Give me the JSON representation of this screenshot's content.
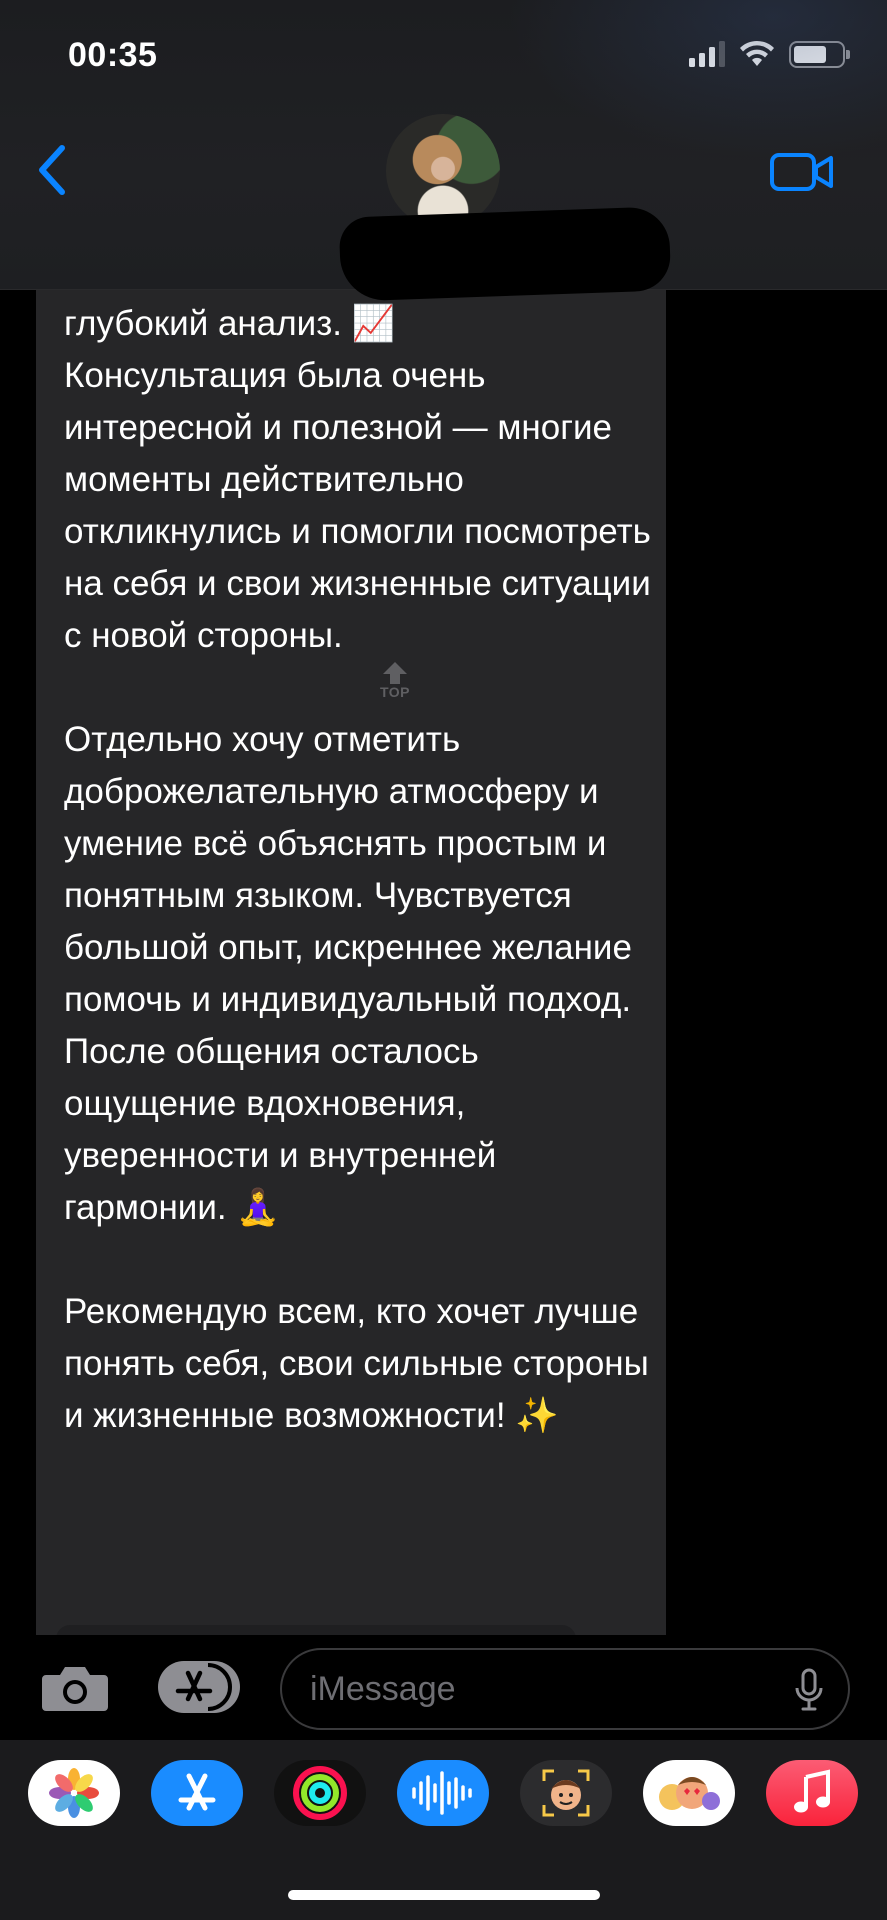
{
  "status_bar": {
    "time": "00:35"
  },
  "header": {
    "contact_avatar": "contact-photo",
    "back_icon": "chevron-left-icon",
    "video_icon": "video-camera-icon"
  },
  "conversation": {
    "message_text": "глубокий анализ. 📈\nКонсультация была очень интересной и полезной — многие моменты действительно откликнулись и помогли посмотреть на себя и свои жизненные ситуации с новой стороны.\n\nОтдельно хочу отметить доброжелательную атмосферу и умение всё объяснять простым и понятным языком. Чувствуется большой опыт, искреннее желание помочь и индивидуальный подход. После общения осталось ощущение вдохновения, уверенности и внутренней гармонии. 🧘‍♀️\n\nРекомендую всем, кто хочет лучше понять себя, свои сильные стороны и жизненные возможности! ✨",
    "top_badge_label": "TOP"
  },
  "input_bar": {
    "placeholder": "iMessage",
    "camera_icon": "camera-icon",
    "apps_icon": "app-store-icon",
    "mic_icon": "microphone-icon"
  },
  "app_drawer": {
    "apps": [
      {
        "name": "Photos",
        "icon": "photos-icon"
      },
      {
        "name": "App Store",
        "icon": "app-store-icon"
      },
      {
        "name": "Activity",
        "icon": "activity-rings-icon"
      },
      {
        "name": "Audio Message",
        "icon": "waveform-icon"
      },
      {
        "name": "Memoji",
        "icon": "memoji-icon"
      },
      {
        "name": "Memoji Stickers",
        "icon": "memoji-stickers-icon"
      },
      {
        "name": "Music",
        "icon": "music-icon"
      }
    ]
  },
  "colors": {
    "accent": "#0a84ff",
    "bubble": "#262628",
    "background": "#000000",
    "placeholder": "#6e6e73"
  }
}
